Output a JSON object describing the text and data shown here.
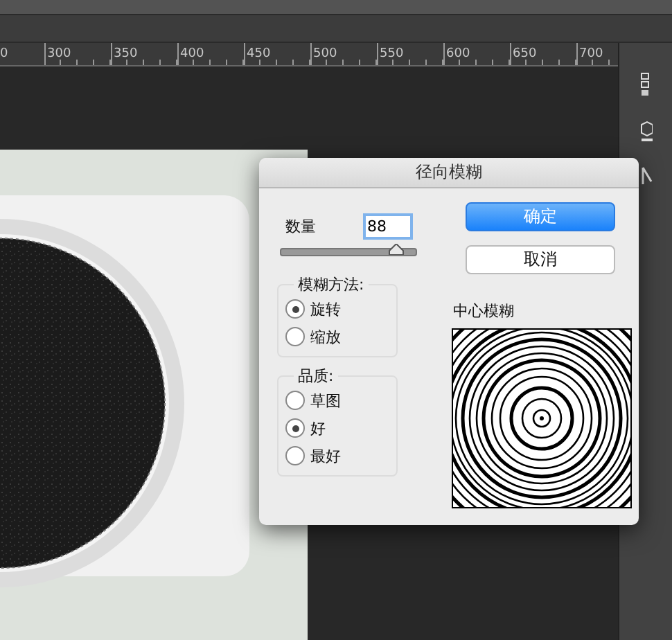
{
  "ruler": {
    "labels": [
      "0",
      "300",
      "350",
      "400",
      "450",
      "500",
      "550",
      "600",
      "650",
      "700"
    ]
  },
  "dialog": {
    "title": "径向模糊",
    "amount": {
      "label": "数量",
      "value": "88",
      "level": 0.86
    },
    "buttons": [
      {
        "label": "确定",
        "kind": "primary"
      },
      {
        "label": "取消",
        "kind": "default"
      }
    ],
    "groups": [
      {
        "title": "模糊方法:",
        "options": [
          {
            "label": "旋转",
            "selected": true
          },
          {
            "label": "缩放",
            "selected": false
          }
        ]
      },
      {
        "title": "品质:",
        "options": [
          {
            "label": "草图",
            "selected": false
          },
          {
            "label": "好",
            "selected": true
          },
          {
            "label": "最好",
            "selected": false
          }
        ]
      }
    ],
    "center": {
      "label": "中心模糊"
    }
  }
}
